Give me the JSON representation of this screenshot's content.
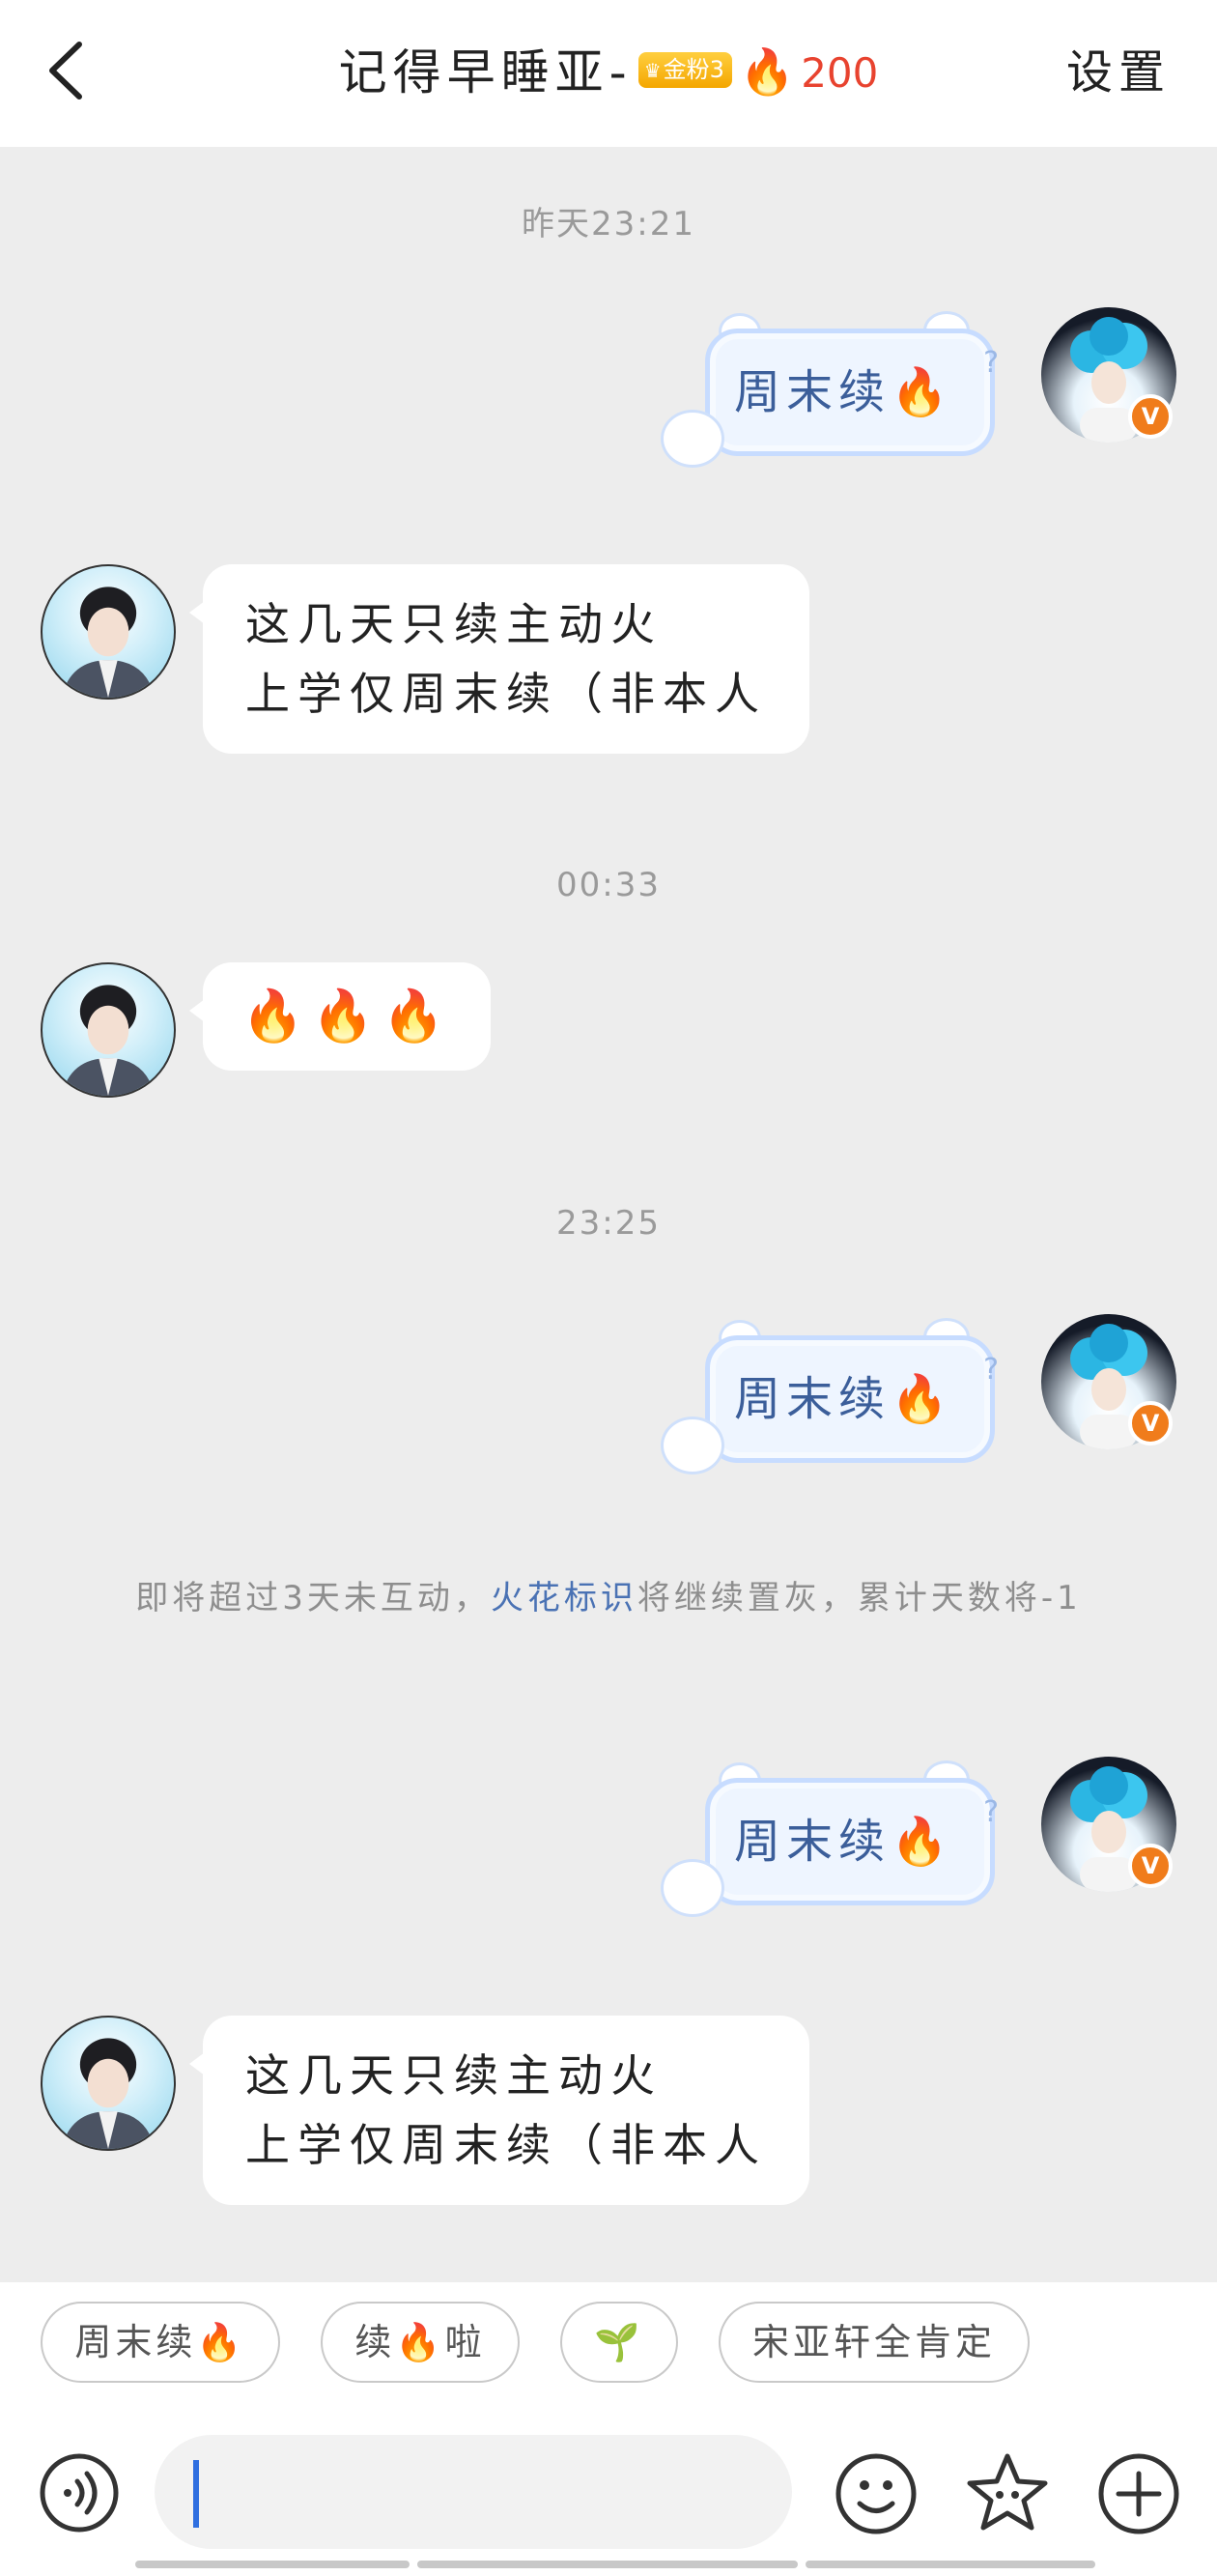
{
  "header": {
    "back_label": "‹",
    "title": "记得早睡亚-",
    "fan_badge": "金粉3",
    "fire_count": "200",
    "settings": "设置"
  },
  "messages": {
    "ts1": "昨天23:21",
    "m1": "周末续🔥",
    "m2_line1": "这几天只续主动火",
    "m2_line2": "上学仅周末续（非本人",
    "ts2": "00:33",
    "m3": "🔥🔥🔥",
    "ts3": "23:25",
    "m4": "周末续🔥",
    "notice_part1": "即将超过3天未互动，",
    "notice_link": "火花标识",
    "notice_part2": "将继续置灰，累计天数将-1",
    "m5": "周末续🔥",
    "m6_line1": "这几天只续主动火",
    "m6_line2": "上学仅周末续（非本人"
  },
  "quick_replies": [
    "周末续🔥",
    "续🔥啦",
    "🌱",
    "宋亚轩全肯定"
  ],
  "input": {
    "value": "",
    "placeholder": ""
  },
  "icons": {
    "verified_badge": "V",
    "back": "chevron-left-icon",
    "voice": "voice-icon",
    "emoji": "emoji-icon",
    "sticker": "star-sticker-icon",
    "more": "plus-icon"
  },
  "colors": {
    "accent_link": "#4a72b4",
    "fire": "#e8432f",
    "badge_gold": "#f4a600",
    "verified": "#f07c1b"
  }
}
